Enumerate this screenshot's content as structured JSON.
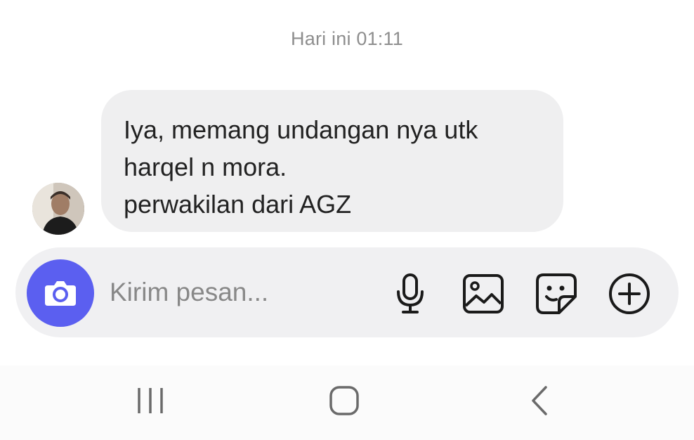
{
  "chat": {
    "timestamp": "Hari ini 01:11",
    "message": {
      "lines": [
        "Iya, memang undangan nya utk",
        "harqel n mora.",
        "perwakilan dari AGZ"
      ]
    }
  },
  "composer": {
    "placeholder": "Kirim pesan...",
    "camera_icon": "camera-icon",
    "actions": [
      "microphone-icon",
      "image-icon",
      "sticker-icon",
      "plus-circle-icon"
    ]
  },
  "navbar": {
    "buttons": [
      "recent-apps-icon",
      "home-icon",
      "back-icon"
    ]
  },
  "colors": {
    "accent": "#5b5ff0",
    "bubble": "#efeff0",
    "composer": "#f0f0f2",
    "timestamp": "#8e8e8e"
  }
}
